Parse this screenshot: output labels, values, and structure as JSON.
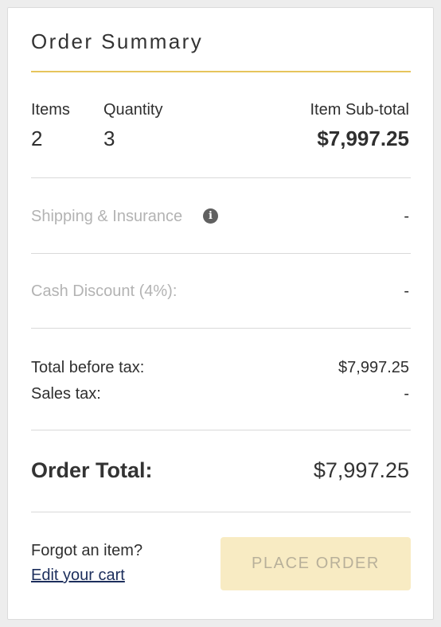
{
  "summary": {
    "title": "Order Summary",
    "items_label": "Items",
    "items_value": "2",
    "quantity_label": "Quantity",
    "quantity_value": "3",
    "subtotal_label": "Item Sub-total",
    "subtotal_value": "$7,997.25",
    "shipping_label": "Shipping & Insurance",
    "shipping_value": "-",
    "shipping_info_icon": "info-icon",
    "discount_label": "Cash Discount (4%):",
    "discount_value": "-",
    "before_tax_label": "Total before tax:",
    "before_tax_value": "$7,997.25",
    "sales_tax_label": "Sales tax:",
    "sales_tax_value": "-",
    "order_total_label": "Order Total:",
    "order_total_value": "$7,997.25"
  },
  "footer": {
    "forgot_text": "Forgot an item?",
    "edit_cart_link": "Edit your cart",
    "place_order_label": "PLACE ORDER"
  },
  "colors": {
    "accent_rule": "#e6c45c",
    "button_bg_disabled": "#f8ebc3",
    "link": "#1c2e5c",
    "muted_text": "#b3b3b3"
  }
}
